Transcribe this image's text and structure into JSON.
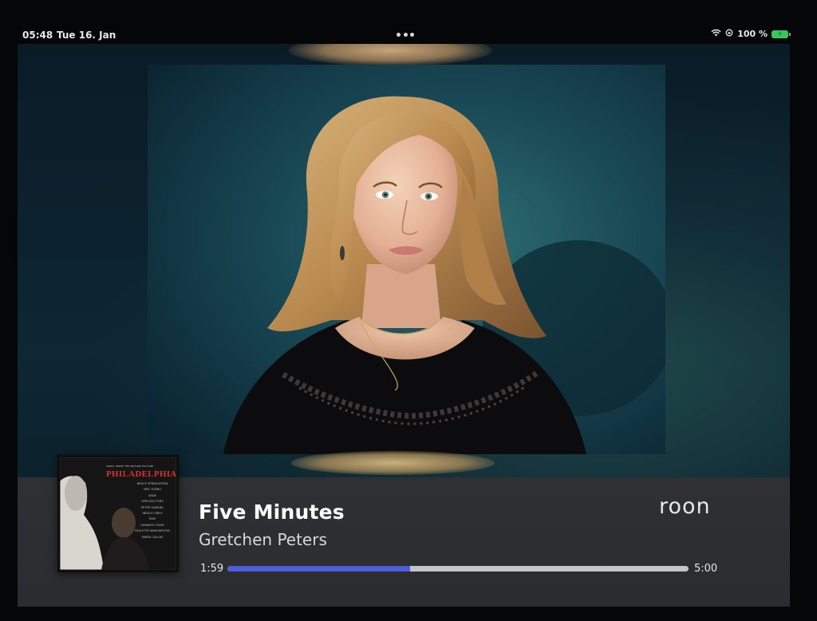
{
  "status_bar": {
    "time": "05:48",
    "date": "Tue 16. Jan",
    "battery_percent": "100 %"
  },
  "now_playing": {
    "title": "Five Minutes",
    "artist": "Gretchen Peters",
    "elapsed": "1:59",
    "duration": "5:00",
    "progress_fraction": 0.397,
    "app_logo": "roon",
    "album_cover": {
      "title": "PHILADELPHIA",
      "subtitle": "MUSIC FROM THE MOTION PICTURE",
      "tracklist_artists": [
        "BRUCE SPRINGSTEEN",
        "NEIL YOUNG",
        "SADE",
        "SPIN DOCTORS",
        "PETER GABRIEL",
        "INDIGO GIRLS",
        "RAM",
        "HUMAN'S CHOIR",
        "PAULETTE WASHINGTON",
        "MARIA CALLAS"
      ]
    }
  },
  "colors": {
    "progress_fill": "#4f5ed8",
    "progress_track": "#c3c5c8",
    "battery": "#35c759",
    "cover_title": "#d6322b"
  },
  "icons": [
    "wifi-icon",
    "orientation-lock-icon",
    "battery-charging-icon",
    "more-dots-icon"
  ]
}
